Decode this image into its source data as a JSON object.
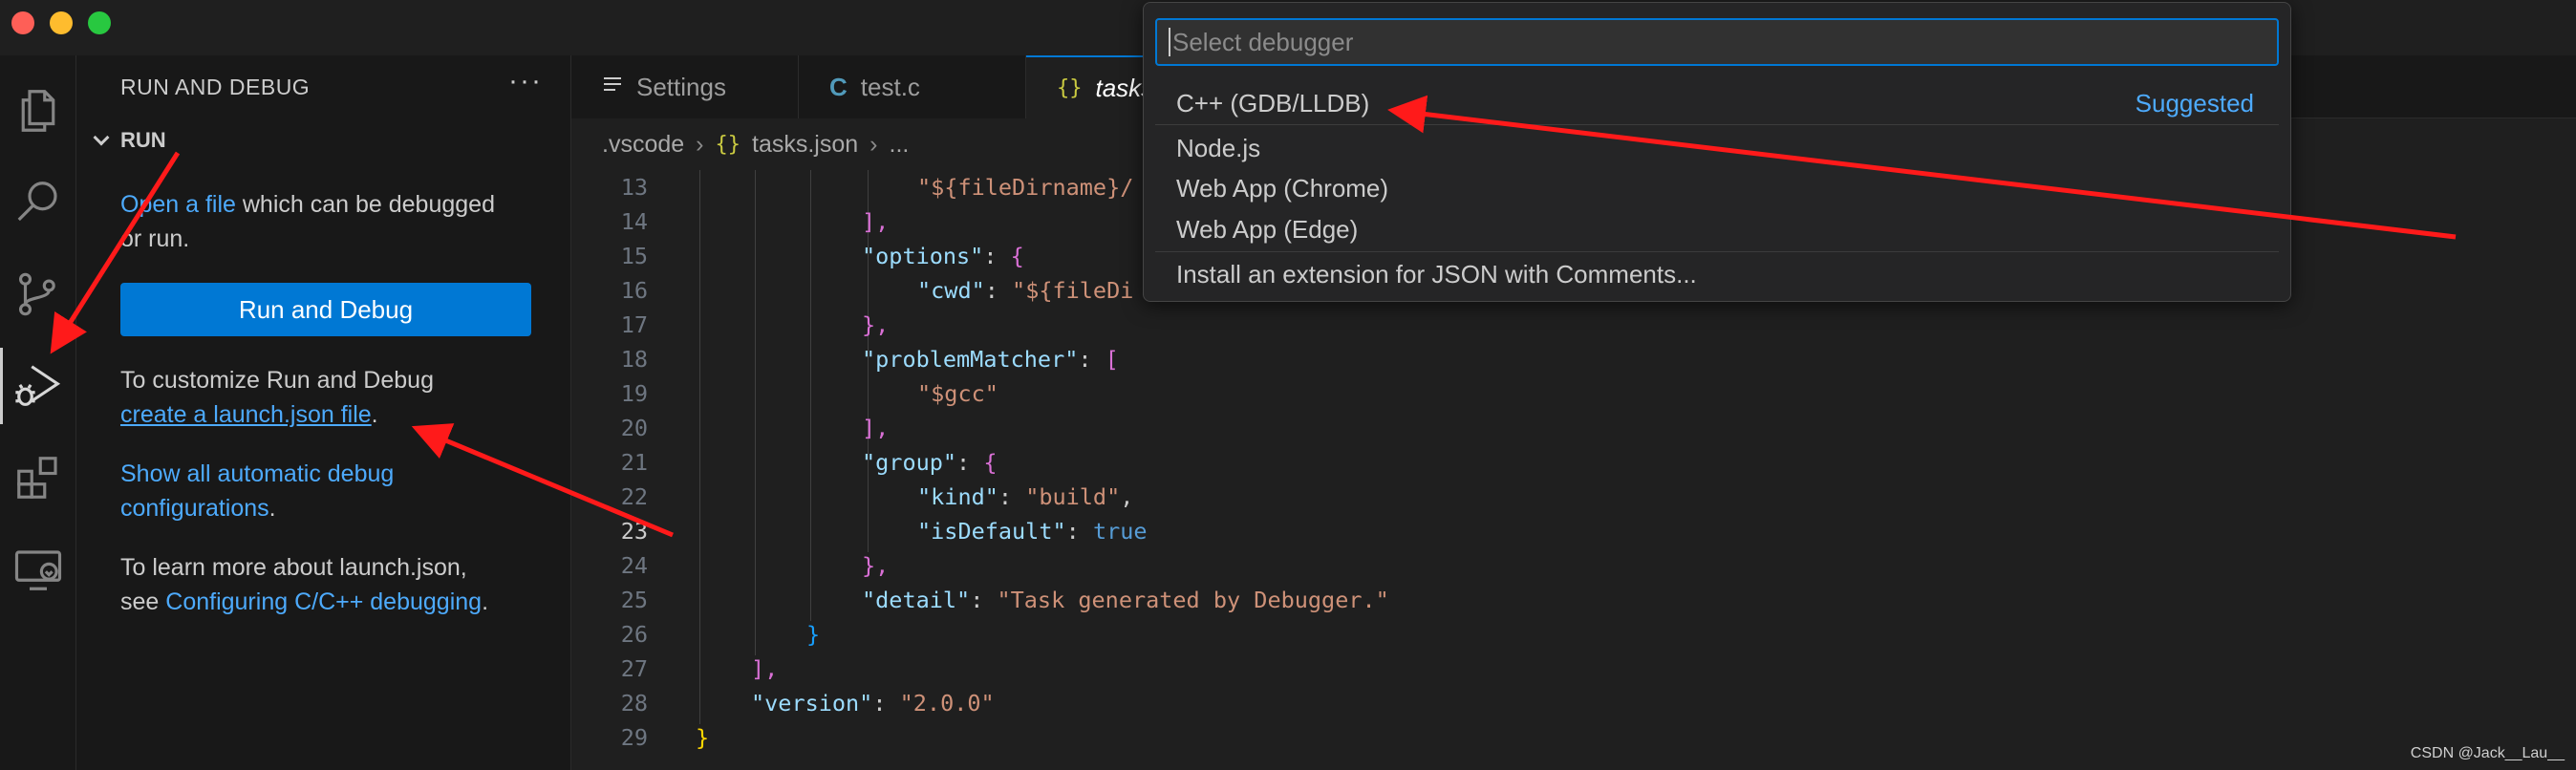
{
  "sidebar": {
    "title": "RUN AND DEBUG",
    "more": "···",
    "section": "RUN",
    "open_link": "Open a file",
    "open_rest1": " which can be debugged",
    "open_rest2": "or run.",
    "run_button": "Run and Debug",
    "customize_text": "To customize Run and Debug",
    "create_link": "create a launch.json file",
    "create_after": ".",
    "show_all_1": "Show all automatic debug",
    "show_all_2": "configurations",
    "show_all_after": ".",
    "learn_1": "To learn more about launch.json,",
    "learn_2": "see ",
    "learn_link": "Configuring C/C++ debugging",
    "learn_after": "."
  },
  "tabs": [
    {
      "label": "Settings",
      "icon": "settings-lines-icon"
    },
    {
      "label": "test.c",
      "icon": "c-file-icon",
      "glyph": "C"
    },
    {
      "label": "tasks.json",
      "icon": "json-braces-icon",
      "glyph": "{}"
    }
  ],
  "breadcrumb": {
    "folder": ".vscode",
    "file_icon": "{}",
    "file": "tasks.json",
    "tail": "..."
  },
  "quickpick": {
    "placeholder": "Select debugger",
    "items": [
      {
        "label": "C++ (GDB/LLDB)",
        "badge": "Suggested"
      },
      {
        "label": "Node.js"
      },
      {
        "label": "Web App (Chrome)"
      },
      {
        "label": "Web App (Edge)"
      },
      {
        "label": "Install an extension for JSON with Comments..."
      }
    ]
  },
  "editor": {
    "line_numbers": [
      "13",
      "14",
      "15",
      "16",
      "17",
      "18",
      "19",
      "20",
      "21",
      "22",
      "23",
      "24",
      "25",
      "26",
      "27",
      "28",
      "29"
    ],
    "current_line": "23",
    "l13": "\"${fileDirname}/",
    "l14": "],",
    "l15_key": "\"options\"",
    "l15_rest": ": ",
    "l16_key": "\"cwd\"",
    "l16_val": "\"${fileDi",
    "l17": "},",
    "l18_key": "\"problemMatcher\"",
    "l19_val": "\"$gcc\"",
    "l20": "],",
    "l21_key": "\"group\"",
    "l22_key": "\"kind\"",
    "l22_val": "\"build\"",
    "l23_key": "\"isDefault\"",
    "l23_val": "true",
    "l24": "},",
    "l25_key": "\"detail\"",
    "l25_val": "\"Task generated by Debugger.\"",
    "l26": "}",
    "l27": "],",
    "l28_key": "\"version\"",
    "l28_val": "\"2.0.0\"",
    "l29": "}"
  },
  "watermark": "CSDN @Jack__Lau__",
  "colors": {
    "accent": "#0078d4",
    "link": "#4daafc",
    "arrow": "#ff1a1a"
  }
}
